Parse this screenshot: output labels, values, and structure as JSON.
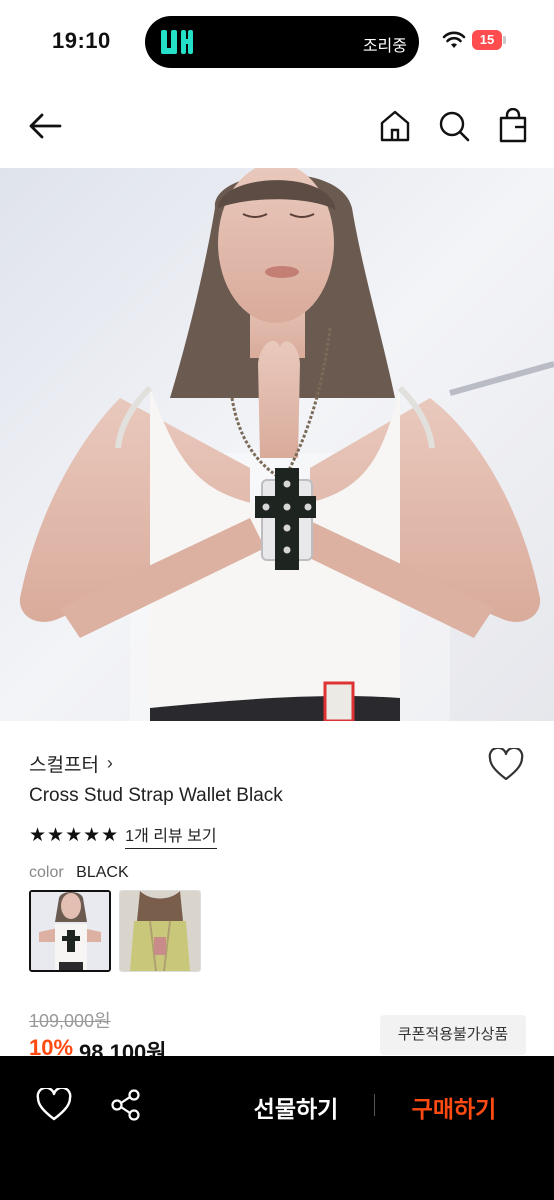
{
  "status_bar": {
    "time": "19:10",
    "island_text": "조리중",
    "battery": "15"
  },
  "header": {
    "icons": [
      "back-arrow-icon",
      "home-icon",
      "search-icon",
      "shopping-bag-icon"
    ]
  },
  "product": {
    "brand": "스컬프터",
    "brand_chevron": "›",
    "title": "Cross Stud Strap Wallet Black",
    "stars": "★★★★★",
    "review_link": "1개 리뷰 보기",
    "color_label": "color",
    "color_value": "BLACK",
    "original_price": "109,000원",
    "discount": "10%",
    "final_price": "98,100원",
    "coupon_badge": "쿠폰적용불가상품"
  },
  "bottom_bar": {
    "gift_label": "선물하기",
    "buy_label": "구매하기"
  },
  "colors": {
    "accent": "#ff4b12",
    "bottom_bar": "#000000",
    "island_logo": "#24e0c8",
    "battery": "#ff4d4f"
  }
}
